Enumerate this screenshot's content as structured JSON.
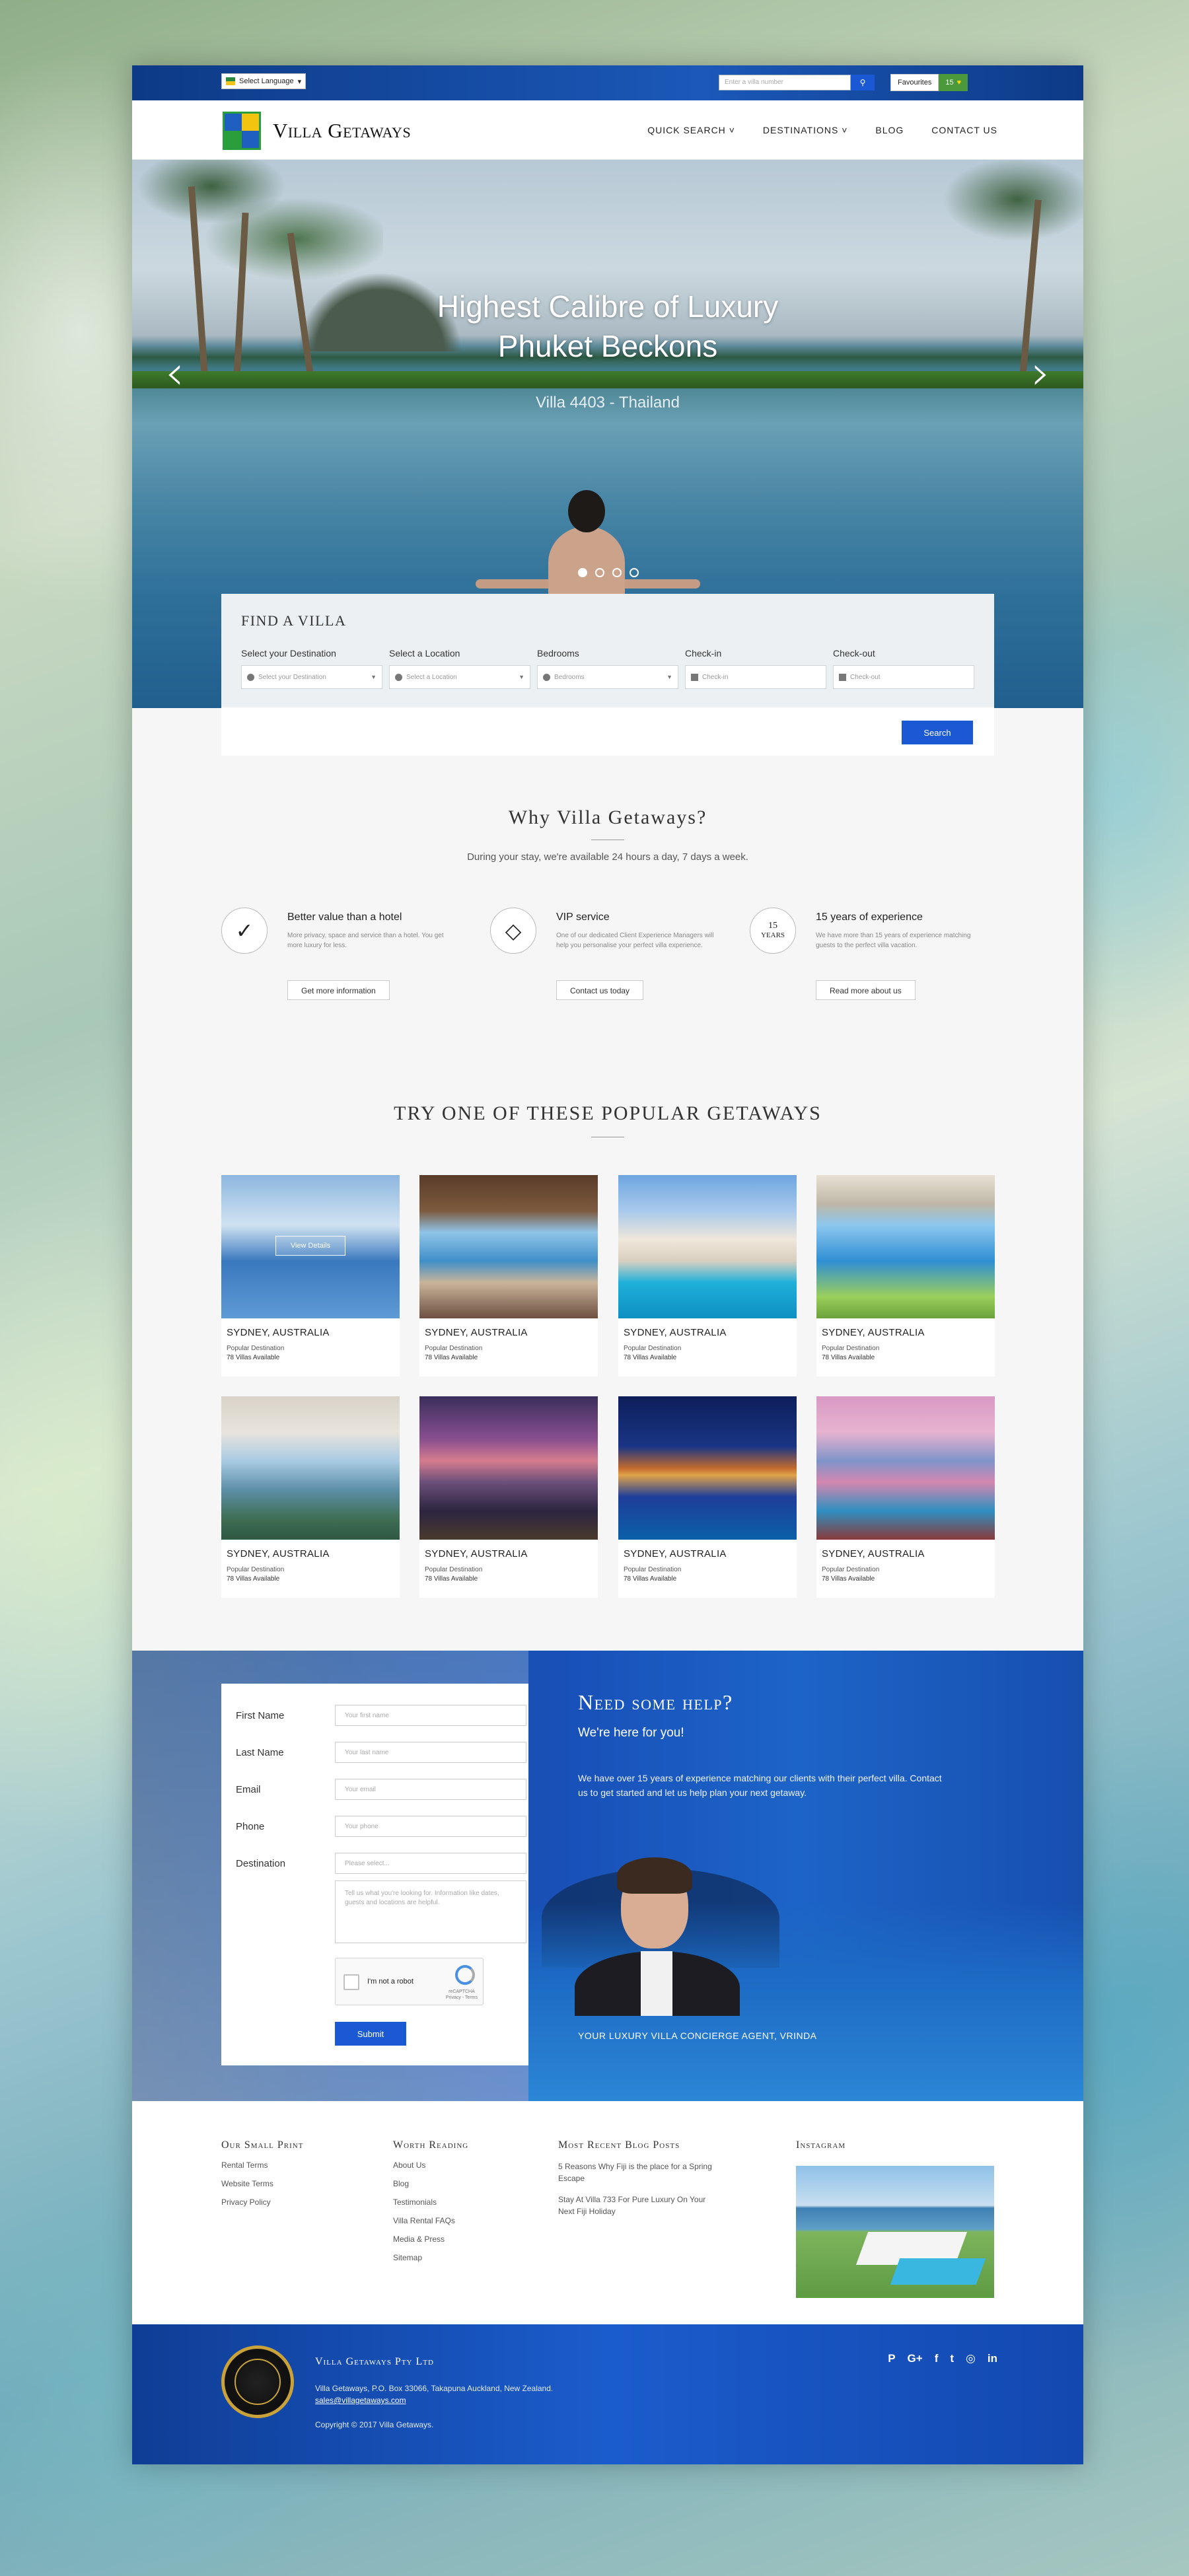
{
  "topbar": {
    "language": "Select Language",
    "villa_search_placeholder": "Enter a villa number",
    "favourites_label": "Favourites",
    "favourites_count": "15"
  },
  "nav": {
    "brand": "Villa Getaways",
    "items": [
      "QUICK SEARCH",
      "DESTINATIONS",
      "BLOG",
      "CONTACT US"
    ]
  },
  "hero": {
    "title_line1": "Highest Calibre of Luxury",
    "title_line2": "Phuket Beckons",
    "subtitle": "Villa 4403 - Thailand",
    "slides": 4,
    "active_slide": 1
  },
  "find": {
    "title": "FIND A VILLA",
    "fields": [
      {
        "label": "Select your Destination",
        "placeholder": "Select your Destination"
      },
      {
        "label": "Select a Location",
        "placeholder": "Select a Location"
      },
      {
        "label": "Bedrooms",
        "placeholder": "Bedrooms"
      },
      {
        "label": "Check-in",
        "placeholder": "Check-in"
      },
      {
        "label": "Check-out",
        "placeholder": "Check-out"
      }
    ],
    "button": "Search"
  },
  "why": {
    "title": "Why Villa Getaways?",
    "subtitle": "During your stay, we're available 24 hours a day, 7 days a week.",
    "features": [
      {
        "title": "Better value than a hotel",
        "text": "More privacy, space and service than a hotel. You get more luxury for less.",
        "button": "Get more information",
        "icon": "check-icon"
      },
      {
        "title": "VIP service",
        "text": "One of our dedicated Client Experience Managers will help you personalise your perfect villa experience.",
        "button": "Contact us today",
        "icon": "diamond-icon"
      },
      {
        "title": "15 years of experience",
        "text": "We have more than 15 years of experience matching guests to the perfect villa vacation.",
        "button": "Read more about us",
        "icon_text_top": "15",
        "icon_text_bottom": "YEARS"
      }
    ]
  },
  "popular": {
    "title": "TRY ONE OF THESE POPULAR GETAWAYS",
    "view_details": "View Details",
    "cards": [
      {
        "location": "SYDNEY, AUSTRALIA",
        "tag": "Popular Destination",
        "count": "78 Villas Available"
      },
      {
        "location": "SYDNEY, AUSTRALIA",
        "tag": "Popular Destination",
        "count": "78 Villas Available"
      },
      {
        "location": "SYDNEY, AUSTRALIA",
        "tag": "Popular Destination",
        "count": "78 Villas Available"
      },
      {
        "location": "SYDNEY, AUSTRALIA",
        "tag": "Popular Destination",
        "count": "78 Villas Available"
      },
      {
        "location": "SYDNEY, AUSTRALIA",
        "tag": "Popular Destination",
        "count": "78 Villas Available"
      },
      {
        "location": "SYDNEY, AUSTRALIA",
        "tag": "Popular Destination",
        "count": "78 Villas Available"
      },
      {
        "location": "SYDNEY, AUSTRALIA",
        "tag": "Popular Destination",
        "count": "78 Villas Available"
      },
      {
        "location": "SYDNEY, AUSTRALIA",
        "tag": "Popular Destination",
        "count": "78 Villas Available"
      }
    ]
  },
  "contact_form": {
    "fields": [
      {
        "label": "First Name",
        "placeholder": "Your first name"
      },
      {
        "label": "Last Name",
        "placeholder": "Your last name"
      },
      {
        "label": "Email",
        "placeholder": "Your email"
      },
      {
        "label": "Phone",
        "placeholder": "Your phone"
      },
      {
        "label": "Destination",
        "placeholder": "Please select..."
      }
    ],
    "message_placeholder": "Tell us what you're looking for. Information like dates, guests and locations are helpful.",
    "captcha_label": "I'm not a robot",
    "captcha_brand": "reCAPTCHA",
    "captcha_links": "Privacy - Terms",
    "submit": "Submit"
  },
  "help": {
    "title": "Need some help?",
    "subtitle": "We're here for you!",
    "text": "We have over 15 years of experience matching our clients with their perfect villa. Contact us to get started and let us help plan your next getaway.",
    "agent_caption": "YOUR LUXURY VILLA CONCIERGE AGENT, VRINDA"
  },
  "footer": {
    "col1": {
      "title": "Our Small Print",
      "links": [
        "Rental Terms",
        "Website Terms",
        "Privacy Policy"
      ]
    },
    "col2": {
      "title": "Worth Reading",
      "links": [
        "About Us",
        "Blog",
        "Testimonials",
        "Villa Rental FAQs",
        "Media & Press",
        "Sitemap"
      ]
    },
    "col3": {
      "title": "Most Recent Blog Posts",
      "posts": [
        "5 Reasons Why Fiji is the place for a Spring Escape",
        "Stay At Villa 733 For Pure Luxury On Your Next Fiji Holiday"
      ]
    },
    "col4": {
      "title": "Instagram"
    }
  },
  "bottom": {
    "company": "Villa Getaways Pty Ltd",
    "address": "Villa Getaways, P.O. Box 33066, Takapuna Auckland, New Zealand.",
    "email": "sales@villagetaways.com",
    "copyright": "Copyright © 2017 Villa Getaways.",
    "social": [
      "pinterest-icon",
      "google-plus-icon",
      "facebook-icon",
      "twitter-icon",
      "instagram-icon",
      "linkedin-icon"
    ]
  }
}
